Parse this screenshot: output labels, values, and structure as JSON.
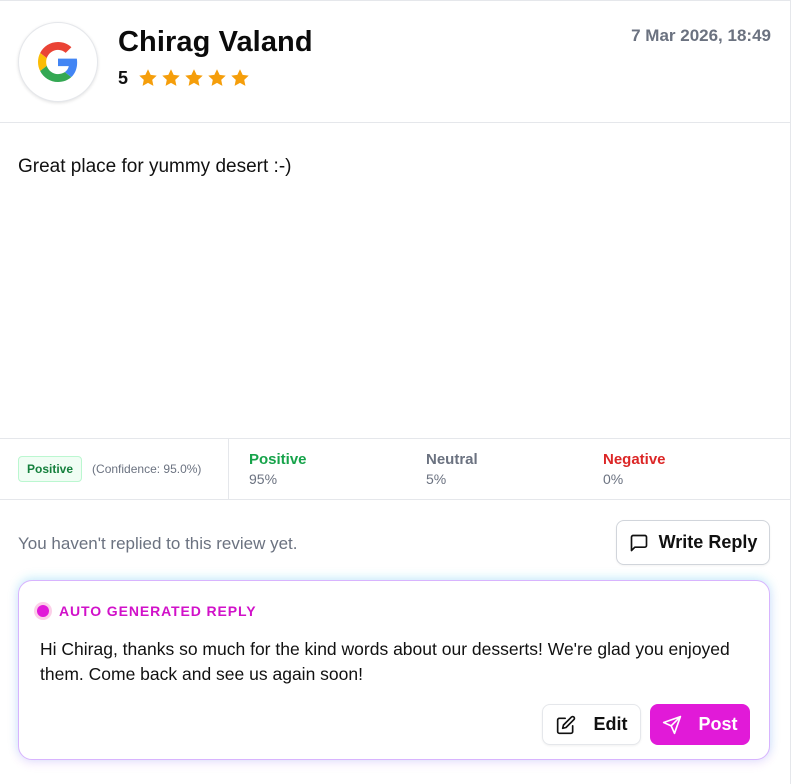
{
  "review": {
    "reviewer_name": "Chirag Valand",
    "rating": "5",
    "stars_filled": 5,
    "stars_total": 5,
    "timestamp": "7 Mar 2026, 18:49",
    "source_icon": "google-g-icon",
    "text": "Great place for yummy desert :-)"
  },
  "sentiment": {
    "badge": "Positive",
    "confidence": "(Confidence: 95.0%)",
    "columns": [
      {
        "label": "Positive",
        "value": "95%",
        "color": "#16a34a"
      },
      {
        "label": "Neutral",
        "value": "5%",
        "color": "#6b7280"
      },
      {
        "label": "Negative",
        "value": "0%",
        "color": "#dc2626"
      }
    ]
  },
  "reply": {
    "status_text": "You haven't replied to this review yet.",
    "write_reply_label": "Write Reply",
    "write_reply_icon": "message-square-icon"
  },
  "auto_reply": {
    "title": "AUTO GENERATED REPLY",
    "text": "Hi Chirag, thanks so much for the kind words about our desserts! We're glad you enjoyed them. Come back and see us again soon!",
    "edit_label": "Edit",
    "edit_icon": "edit-icon",
    "post_label": "Post",
    "post_icon": "send-icon"
  },
  "colors": {
    "star": "#f59e0b",
    "accent": "#e11ad8",
    "positive": "#16a34a",
    "negative": "#dc2626",
    "muted": "#6b7280"
  }
}
